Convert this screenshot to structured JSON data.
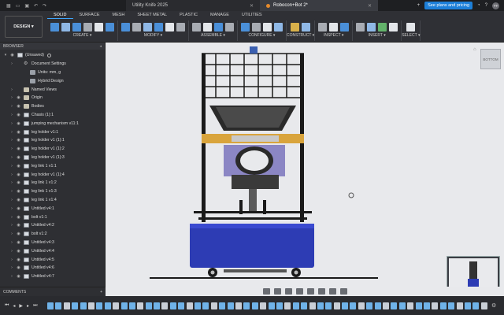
{
  "titlebar": {
    "tabs": [
      {
        "label": "Utility Knife 2025",
        "close": "✕"
      },
      {
        "label": "Robocon+Bot 2*",
        "close": "✕"
      }
    ],
    "plans_button": "See plans and pricing",
    "avatar_initials": "TT"
  },
  "ribbon": {
    "workspace": "DESIGN ▾",
    "tabs": [
      "SOLID",
      "SURFACE",
      "MESH",
      "SHEET METAL",
      "PLASTIC",
      "MANAGE",
      "UTILITIES"
    ],
    "groups": [
      {
        "label": "CREATE ▾",
        "icons": [
          "blue",
          "lblue",
          "blue",
          "grey",
          "white",
          "blue"
        ]
      },
      {
        "label": "MODIFY ▾",
        "icons": [
          "blue",
          "grey",
          "lblue",
          "blue",
          "white",
          "grey"
        ]
      },
      {
        "label": "ASSEMBLE ▾",
        "icons": [
          "grey",
          "white",
          "blue",
          "grey"
        ]
      },
      {
        "label": "CONFIGURE ▾",
        "icons": [
          "blue",
          "grey",
          "white",
          "lblue"
        ]
      },
      {
        "label": "CONSTRUCT ▾",
        "icons": [
          "yellow",
          "lblue"
        ]
      },
      {
        "label": "INSPECT ▾",
        "icons": [
          "grey",
          "white",
          "blue"
        ]
      },
      {
        "label": "INSERT ▾",
        "icons": [
          "grey",
          "lblue",
          "green",
          "white"
        ]
      },
      {
        "label": "SELECT ▾",
        "icons": [
          "white"
        ]
      }
    ]
  },
  "browser": {
    "header": "BROWSER",
    "root": "(Unsaved)",
    "items": [
      {
        "label": "Document Settings",
        "level": 1,
        "icon": "gear",
        "eye": false
      },
      {
        "label": "Units: mm, g",
        "level": 2,
        "icon": "doc",
        "eye": false
      },
      {
        "label": "Hybrid Design",
        "level": 2,
        "icon": "doc",
        "eye": false
      },
      {
        "label": "Named Views",
        "level": 1,
        "icon": "folder",
        "eye": false
      },
      {
        "label": "Origin",
        "level": 1,
        "icon": "folder",
        "eye": true
      },
      {
        "label": "Bodies",
        "level": 1,
        "icon": "folder",
        "eye": true
      },
      {
        "label": "Chasis (1):1",
        "level": 1,
        "icon": "comp",
        "eye": true
      },
      {
        "label": "jumping mechanism v11:1",
        "level": 1,
        "icon": "comp",
        "eye": true
      },
      {
        "label": "leg holder v1:1",
        "level": 1,
        "icon": "comp",
        "eye": true
      },
      {
        "label": "leg holder v1 (1):1",
        "level": 1,
        "icon": "comp",
        "eye": true
      },
      {
        "label": "leg holder v1 (1):2",
        "level": 1,
        "icon": "comp",
        "eye": true
      },
      {
        "label": "leg holder v1 (1):3",
        "level": 1,
        "icon": "comp",
        "eye": true
      },
      {
        "label": "leg link 1 v1:1",
        "level": 1,
        "icon": "comp",
        "eye": true
      },
      {
        "label": "leg holder v1 (1):4",
        "level": 1,
        "icon": "comp",
        "eye": true
      },
      {
        "label": "leg link 1 v1:2",
        "level": 1,
        "icon": "comp",
        "eye": true
      },
      {
        "label": "leg link 1 v1:3",
        "level": 1,
        "icon": "comp",
        "eye": true
      },
      {
        "label": "leg link 1 v1:4",
        "level": 1,
        "icon": "comp",
        "eye": true
      },
      {
        "label": "Untitled v4:1",
        "level": 1,
        "icon": "comp",
        "eye": true
      },
      {
        "label": "bolt v1:1",
        "level": 1,
        "icon": "comp",
        "eye": true
      },
      {
        "label": "Untitled v4:2",
        "level": 1,
        "icon": "comp",
        "eye": true
      },
      {
        "label": "bolt v1:2",
        "level": 1,
        "icon": "comp",
        "eye": true
      },
      {
        "label": "Untitled v4:3",
        "level": 1,
        "icon": "comp",
        "eye": true
      },
      {
        "label": "Untitled v4:4",
        "level": 1,
        "icon": "comp",
        "eye": true
      },
      {
        "label": "Untitled v4:5",
        "level": 1,
        "icon": "comp",
        "eye": true
      },
      {
        "label": "Untitled v4:6",
        "level": 1,
        "icon": "comp",
        "eye": true
      },
      {
        "label": "Untitled v4:7",
        "level": 1,
        "icon": "comp",
        "eye": true
      }
    ]
  },
  "viewcube_label": "BOTTOM",
  "comments": {
    "label": "COMMENTS",
    "plus": "+"
  },
  "colors": {
    "accent": "#1d7fd8",
    "robot_blue": "#2d3cb4",
    "frame": "#1a1a1a",
    "brass": "#d9a43c"
  }
}
